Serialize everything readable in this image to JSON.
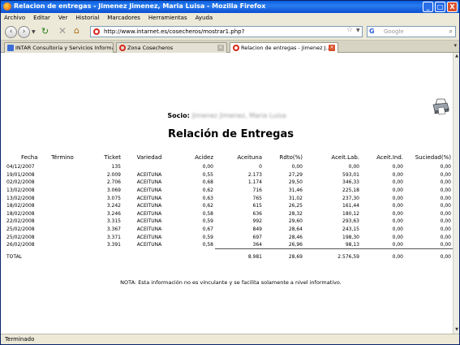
{
  "window": {
    "title": "Relacion de entregas - Jimenez Jimenez, Maria Luisa - Mozilla Firefox",
    "controls": {
      "minimize": "_",
      "maximize": "□",
      "close": "X"
    }
  },
  "menu": [
    "Archivo",
    "Editar",
    "Ver",
    "Historial",
    "Marcadores",
    "Herramientas",
    "Ayuda"
  ],
  "navbar": {
    "url": "http://www.intarnet.es/cosecheros/mostrar1.php?",
    "search_placeholder": "Google"
  },
  "tabs": [
    {
      "label": "INTAR Consultoria y Servicios Informáti...",
      "active": false
    },
    {
      "label": "Zona Cosecheros",
      "active": false
    },
    {
      "label": "Relacion de entregas - Jimenez J...",
      "active": true
    }
  ],
  "report": {
    "socio_label": "Socio:",
    "socio_name": "Jimenez Jimenez, Maria Luisa",
    "title": "Relación de Entregas",
    "columns": [
      "Fecha",
      "Término",
      "Ticket",
      "Variedad",
      "Acidez",
      "Aceituna",
      "Rdto(%)",
      "Aceit.Lab.",
      "Aceit.Ind.",
      "Suciedad(%)"
    ],
    "rows": [
      {
        "fecha": "04/12/2007",
        "termino": "",
        "ticket": "135",
        "variedad": "",
        "acidez": "0,00",
        "aceituna": "0",
        "rdto": "0,00",
        "lab": "0,00",
        "ind": "0,00",
        "suc": "0,00"
      },
      {
        "fecha": "19/01/2008",
        "termino": "",
        "ticket": "2.009",
        "variedad": "ACEITUNA",
        "acidez": "0,55",
        "aceituna": "2.173",
        "rdto": "27,29",
        "lab": "593,01",
        "ind": "0,00",
        "suc": "0,00"
      },
      {
        "fecha": "02/02/2008",
        "termino": "",
        "ticket": "2.706",
        "variedad": "ACEITUNA",
        "acidez": "0,68",
        "aceituna": "1.174",
        "rdto": "29,50",
        "lab": "346,33",
        "ind": "0,00",
        "suc": "0,00"
      },
      {
        "fecha": "13/02/2008",
        "termino": "",
        "ticket": "3.069",
        "variedad": "ACEITUNA",
        "acidez": "0,62",
        "aceituna": "716",
        "rdto": "31,46",
        "lab": "225,18",
        "ind": "0,00",
        "suc": "0,00"
      },
      {
        "fecha": "13/02/2008",
        "termino": "",
        "ticket": "3.075",
        "variedad": "ACEITUNA",
        "acidez": "0,63",
        "aceituna": "765",
        "rdto": "31,02",
        "lab": "237,30",
        "ind": "0,00",
        "suc": "0,00"
      },
      {
        "fecha": "18/02/2008",
        "termino": "",
        "ticket": "3.242",
        "variedad": "ACEITUNA",
        "acidez": "0,62",
        "aceituna": "615",
        "rdto": "26,25",
        "lab": "161,44",
        "ind": "0,00",
        "suc": "0,00"
      },
      {
        "fecha": "18/02/2008",
        "termino": "",
        "ticket": "3.246",
        "variedad": "ACEITUNA",
        "acidez": "0,58",
        "aceituna": "636",
        "rdto": "28,32",
        "lab": "180,12",
        "ind": "0,00",
        "suc": "0,00"
      },
      {
        "fecha": "22/02/2008",
        "termino": "",
        "ticket": "3.315",
        "variedad": "ACEITUNA",
        "acidez": "0,59",
        "aceituna": "992",
        "rdto": "29,60",
        "lab": "293,63",
        "ind": "0,00",
        "suc": "0,00"
      },
      {
        "fecha": "25/02/2008",
        "termino": "",
        "ticket": "3.367",
        "variedad": "ACEITUNA",
        "acidez": "0,67",
        "aceituna": "849",
        "rdto": "28,64",
        "lab": "243,15",
        "ind": "0,00",
        "suc": "0,00"
      },
      {
        "fecha": "25/02/2008",
        "termino": "",
        "ticket": "3.371",
        "variedad": "ACEITUNA",
        "acidez": "0,59",
        "aceituna": "697",
        "rdto": "28,46",
        "lab": "198,30",
        "ind": "0,00",
        "suc": "0,00"
      },
      {
        "fecha": "26/02/2008",
        "termino": "",
        "ticket": "3.391",
        "variedad": "ACEITUNA",
        "acidez": "0,58",
        "aceituna": "364",
        "rdto": "26,96",
        "lab": "98,13",
        "ind": "0,00",
        "suc": "0,00"
      }
    ],
    "total": {
      "label": "TOTAL",
      "aceituna": "8.981",
      "rdto": "28,69",
      "lab": "2.576,59",
      "ind": "0,00",
      "suc": "0,00"
    },
    "nota": "NOTA: Esta información no es vinculante y se facilita solamente a nivel informativo."
  },
  "status": "Terminado",
  "icons": {
    "app": "firefox-icon",
    "back": "back-arrow-icon",
    "forward": "forward-arrow-icon",
    "reload": "reload-icon",
    "stop": "stop-icon",
    "home": "home-icon",
    "bookmark": "star-icon",
    "search": "magnifier-icon",
    "print": "printer-icon"
  },
  "colors": {
    "titlebar": "#0a5ee0",
    "chrome": "#ece9d8",
    "close_button": "#d9512c",
    "page": "#ffffff"
  }
}
